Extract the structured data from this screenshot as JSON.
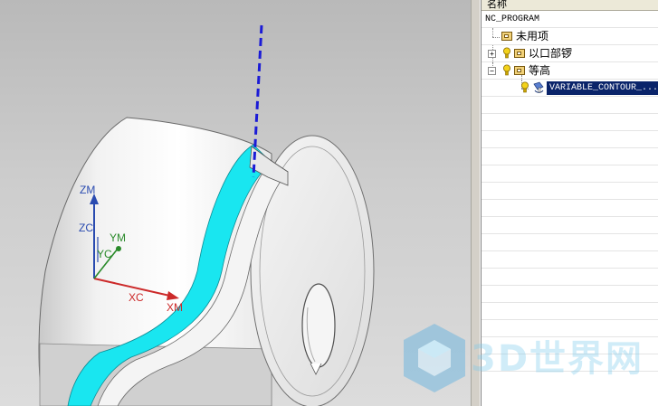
{
  "navigator": {
    "column_header": "名称",
    "root": "NC_PROGRAM",
    "items": [
      {
        "label": "未用项",
        "expander": ""
      },
      {
        "label": "以口部锣",
        "expander": "+"
      },
      {
        "label": "等高",
        "expander": "−"
      },
      {
        "label": "VARIABLE_CONTOUR_...",
        "expander": ""
      }
    ],
    "empty_rows": 16
  },
  "viewport": {
    "axes": {
      "zm": "ZM",
      "zc": "ZC",
      "ym": "YM",
      "yc": "YC",
      "xc": "XC",
      "xm": "XM"
    }
  },
  "colors": {
    "axis_z": "#2a4bb0",
    "axis_y": "#2a8a2a",
    "axis_x": "#cc2a2a",
    "tool_axis": "#1b1bd6",
    "groove": "#19e6f0",
    "selection": "#0a246a"
  },
  "watermark": {
    "text": "3D世界网",
    "icon": "cube-logo-icon"
  }
}
